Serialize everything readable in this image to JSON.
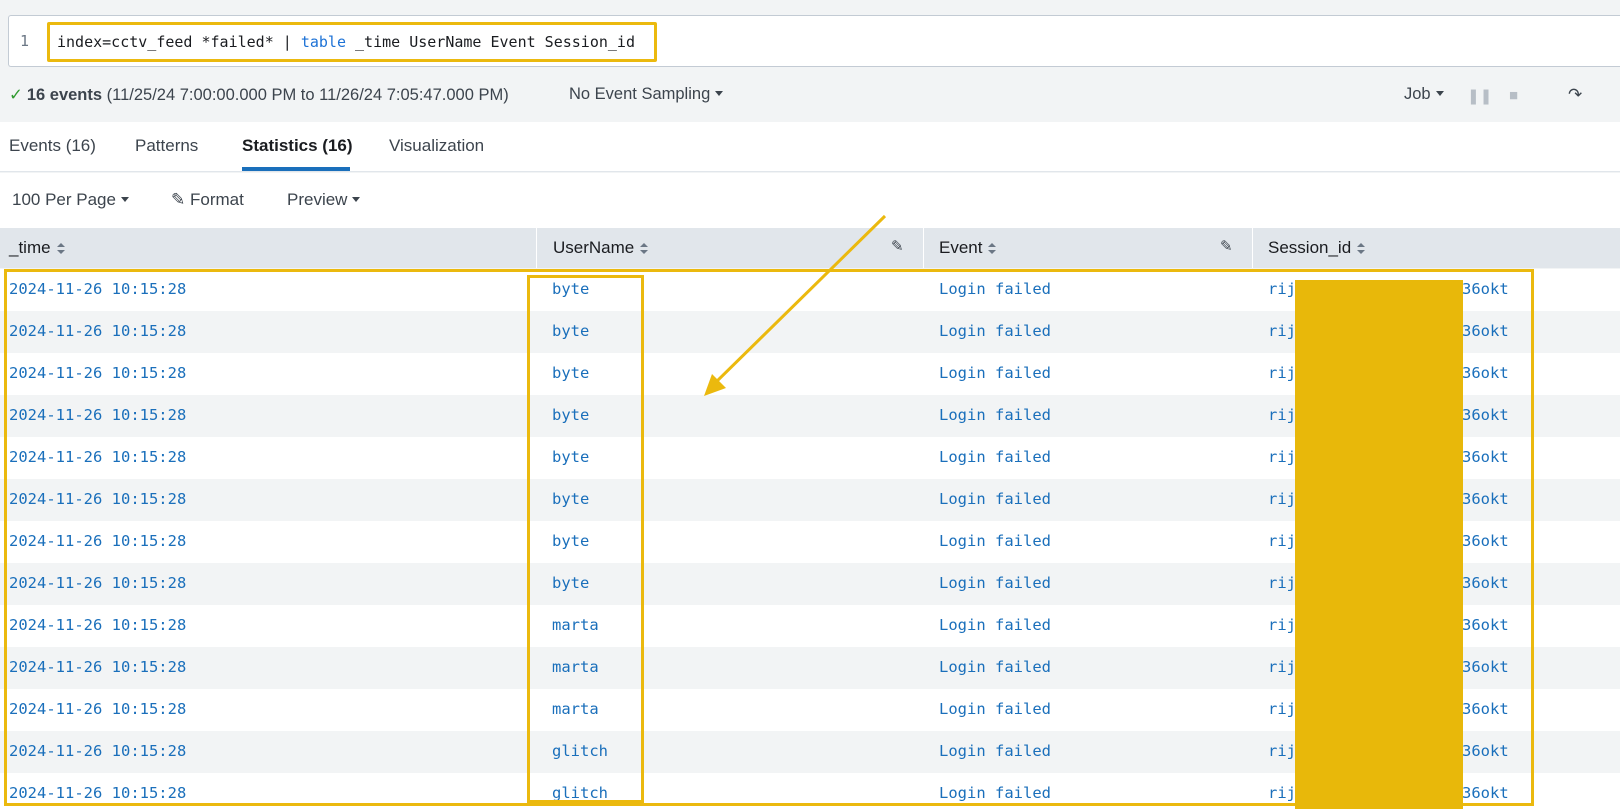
{
  "search": {
    "line_number": "1",
    "query_prefix": "index=cctv_feed *failed* | ",
    "query_keyword": "table",
    "query_suffix": " _time UserName Event Session_id"
  },
  "status": {
    "check": "✓",
    "event_count": "16 events",
    "range": "(11/25/24 7:00:00.000 PM to 11/26/24 7:05:47.000 PM)",
    "sampling": "No Event Sampling",
    "job": "Job"
  },
  "tabs": [
    "Events (16)",
    "Patterns",
    "Statistics (16)",
    "Visualization"
  ],
  "active_tab": "Statistics (16)",
  "toolbar": {
    "per_page": "100 Per Page",
    "format": "Format",
    "preview": "Preview"
  },
  "table": {
    "columns": [
      "_time",
      "UserName",
      "Event",
      "Session_id"
    ],
    "rows": [
      {
        "time": "2024-11-26 10:15:28",
        "user": "byte",
        "event": "Login failed",
        "session_start": "rij",
        "session_end": "36okt"
      },
      {
        "time": "2024-11-26 10:15:28",
        "user": "byte",
        "event": "Login failed",
        "session_start": "rij",
        "session_end": "36okt"
      },
      {
        "time": "2024-11-26 10:15:28",
        "user": "byte",
        "event": "Login failed",
        "session_start": "rij",
        "session_end": "36okt"
      },
      {
        "time": "2024-11-26 10:15:28",
        "user": "byte",
        "event": "Login failed",
        "session_start": "rij",
        "session_end": "36okt"
      },
      {
        "time": "2024-11-26 10:15:28",
        "user": "byte",
        "event": "Login failed",
        "session_start": "rij",
        "session_end": "36okt"
      },
      {
        "time": "2024-11-26 10:15:28",
        "user": "byte",
        "event": "Login failed",
        "session_start": "rij",
        "session_end": "36okt"
      },
      {
        "time": "2024-11-26 10:15:28",
        "user": "byte",
        "event": "Login failed",
        "session_start": "rij",
        "session_end": "36okt"
      },
      {
        "time": "2024-11-26 10:15:28",
        "user": "byte",
        "event": "Login failed",
        "session_start": "rij",
        "session_end": "36okt"
      },
      {
        "time": "2024-11-26 10:15:28",
        "user": "marta",
        "event": "Login failed",
        "session_start": "rij",
        "session_end": "36okt"
      },
      {
        "time": "2024-11-26 10:15:28",
        "user": "marta",
        "event": "Login failed",
        "session_start": "rij",
        "session_end": "36okt"
      },
      {
        "time": "2024-11-26 10:15:28",
        "user": "marta",
        "event": "Login failed",
        "session_start": "rij",
        "session_end": "36okt"
      },
      {
        "time": "2024-11-26 10:15:28",
        "user": "glitch",
        "event": "Login failed",
        "session_start": "rij",
        "session_end": "36okt"
      },
      {
        "time": "2024-11-26 10:15:28",
        "user": "glitch",
        "event": "Login failed",
        "session_start": "rij",
        "session_end": "36okt"
      }
    ]
  },
  "colors": {
    "highlight": "#ebb90e",
    "link": "#1a6fbb",
    "active_tab_underline": "#1a6fbb"
  }
}
